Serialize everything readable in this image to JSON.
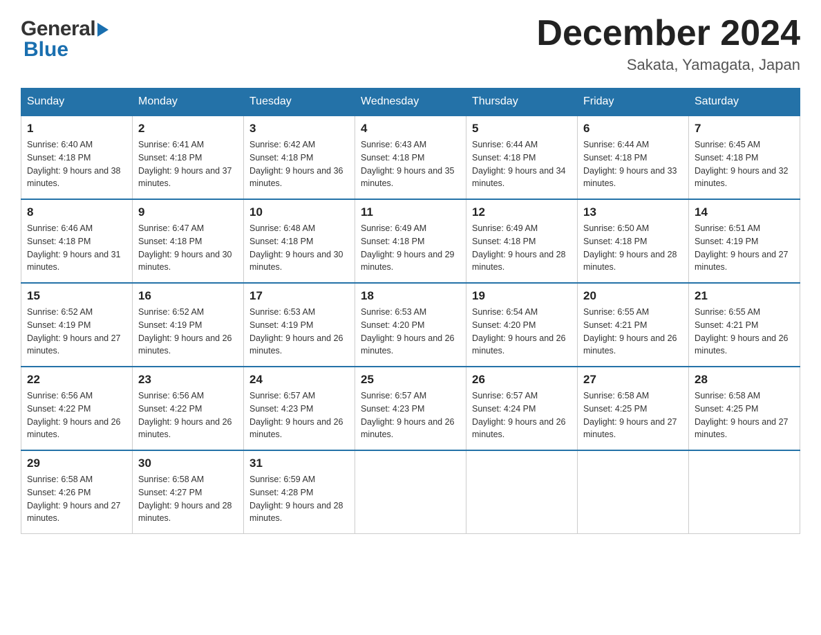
{
  "header": {
    "month_year": "December 2024",
    "location": "Sakata, Yamagata, Japan",
    "logo_general": "General",
    "logo_blue": "Blue"
  },
  "days_of_week": [
    "Sunday",
    "Monday",
    "Tuesday",
    "Wednesday",
    "Thursday",
    "Friday",
    "Saturday"
  ],
  "weeks": [
    [
      {
        "day": "1",
        "sunrise": "6:40 AM",
        "sunset": "4:18 PM",
        "daylight": "9 hours and 38 minutes."
      },
      {
        "day": "2",
        "sunrise": "6:41 AM",
        "sunset": "4:18 PM",
        "daylight": "9 hours and 37 minutes."
      },
      {
        "day": "3",
        "sunrise": "6:42 AM",
        "sunset": "4:18 PM",
        "daylight": "9 hours and 36 minutes."
      },
      {
        "day": "4",
        "sunrise": "6:43 AM",
        "sunset": "4:18 PM",
        "daylight": "9 hours and 35 minutes."
      },
      {
        "day": "5",
        "sunrise": "6:44 AM",
        "sunset": "4:18 PM",
        "daylight": "9 hours and 34 minutes."
      },
      {
        "day": "6",
        "sunrise": "6:44 AM",
        "sunset": "4:18 PM",
        "daylight": "9 hours and 33 minutes."
      },
      {
        "day": "7",
        "sunrise": "6:45 AM",
        "sunset": "4:18 PM",
        "daylight": "9 hours and 32 minutes."
      }
    ],
    [
      {
        "day": "8",
        "sunrise": "6:46 AM",
        "sunset": "4:18 PM",
        "daylight": "9 hours and 31 minutes."
      },
      {
        "day": "9",
        "sunrise": "6:47 AM",
        "sunset": "4:18 PM",
        "daylight": "9 hours and 30 minutes."
      },
      {
        "day": "10",
        "sunrise": "6:48 AM",
        "sunset": "4:18 PM",
        "daylight": "9 hours and 30 minutes."
      },
      {
        "day": "11",
        "sunrise": "6:49 AM",
        "sunset": "4:18 PM",
        "daylight": "9 hours and 29 minutes."
      },
      {
        "day": "12",
        "sunrise": "6:49 AM",
        "sunset": "4:18 PM",
        "daylight": "9 hours and 28 minutes."
      },
      {
        "day": "13",
        "sunrise": "6:50 AM",
        "sunset": "4:18 PM",
        "daylight": "9 hours and 28 minutes."
      },
      {
        "day": "14",
        "sunrise": "6:51 AM",
        "sunset": "4:19 PM",
        "daylight": "9 hours and 27 minutes."
      }
    ],
    [
      {
        "day": "15",
        "sunrise": "6:52 AM",
        "sunset": "4:19 PM",
        "daylight": "9 hours and 27 minutes."
      },
      {
        "day": "16",
        "sunrise": "6:52 AM",
        "sunset": "4:19 PM",
        "daylight": "9 hours and 26 minutes."
      },
      {
        "day": "17",
        "sunrise": "6:53 AM",
        "sunset": "4:19 PM",
        "daylight": "9 hours and 26 minutes."
      },
      {
        "day": "18",
        "sunrise": "6:53 AM",
        "sunset": "4:20 PM",
        "daylight": "9 hours and 26 minutes."
      },
      {
        "day": "19",
        "sunrise": "6:54 AM",
        "sunset": "4:20 PM",
        "daylight": "9 hours and 26 minutes."
      },
      {
        "day": "20",
        "sunrise": "6:55 AM",
        "sunset": "4:21 PM",
        "daylight": "9 hours and 26 minutes."
      },
      {
        "day": "21",
        "sunrise": "6:55 AM",
        "sunset": "4:21 PM",
        "daylight": "9 hours and 26 minutes."
      }
    ],
    [
      {
        "day": "22",
        "sunrise": "6:56 AM",
        "sunset": "4:22 PM",
        "daylight": "9 hours and 26 minutes."
      },
      {
        "day": "23",
        "sunrise": "6:56 AM",
        "sunset": "4:22 PM",
        "daylight": "9 hours and 26 minutes."
      },
      {
        "day": "24",
        "sunrise": "6:57 AM",
        "sunset": "4:23 PM",
        "daylight": "9 hours and 26 minutes."
      },
      {
        "day": "25",
        "sunrise": "6:57 AM",
        "sunset": "4:23 PM",
        "daylight": "9 hours and 26 minutes."
      },
      {
        "day": "26",
        "sunrise": "6:57 AM",
        "sunset": "4:24 PM",
        "daylight": "9 hours and 26 minutes."
      },
      {
        "day": "27",
        "sunrise": "6:58 AM",
        "sunset": "4:25 PM",
        "daylight": "9 hours and 27 minutes."
      },
      {
        "day": "28",
        "sunrise": "6:58 AM",
        "sunset": "4:25 PM",
        "daylight": "9 hours and 27 minutes."
      }
    ],
    [
      {
        "day": "29",
        "sunrise": "6:58 AM",
        "sunset": "4:26 PM",
        "daylight": "9 hours and 27 minutes."
      },
      {
        "day": "30",
        "sunrise": "6:58 AM",
        "sunset": "4:27 PM",
        "daylight": "9 hours and 28 minutes."
      },
      {
        "day": "31",
        "sunrise": "6:59 AM",
        "sunset": "4:28 PM",
        "daylight": "9 hours and 28 minutes."
      },
      null,
      null,
      null,
      null
    ]
  ],
  "labels": {
    "sunrise_prefix": "Sunrise: ",
    "sunset_prefix": "Sunset: ",
    "daylight_prefix": "Daylight: "
  }
}
